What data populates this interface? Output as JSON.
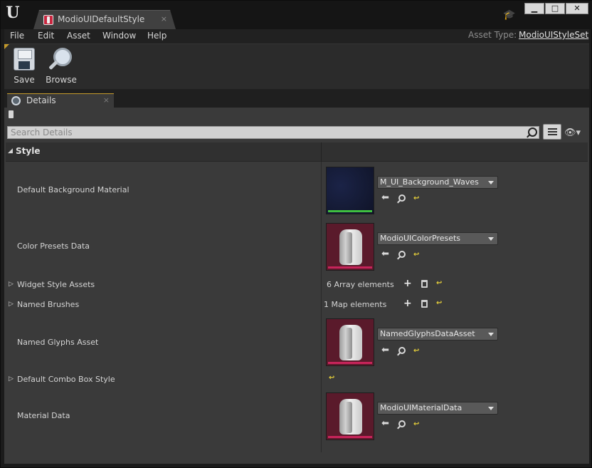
{
  "window": {
    "tab_title": "ModioUIDefaultStyle",
    "tab_close": "×",
    "buttons": {
      "minimize": "▁",
      "maximize": "□",
      "close": "✕"
    }
  },
  "menu": {
    "items": [
      "File",
      "Edit",
      "Asset",
      "Window",
      "Help"
    ],
    "asset_type_label": "Asset Type:",
    "asset_type_value": "ModioUIStyleSet"
  },
  "toolbar": {
    "save_label": "Save",
    "browse_label": "Browse"
  },
  "details": {
    "tab_label": "Details",
    "tab_close": "×",
    "search_placeholder": "Search Details",
    "category": "Style",
    "rows": {
      "default_background_material": {
        "label": "Default Background Material",
        "asset": "M_UI_Background_Waves",
        "thumb_bar_color": "#3fbf3f"
      },
      "color_presets_data": {
        "label": "Color Presets Data",
        "asset": "ModioUIColorPresets",
        "thumb_bar_color": "#c6245a"
      },
      "widget_style_assets": {
        "label": "Widget Style Assets",
        "value": "6 Array elements"
      },
      "named_brushes": {
        "label": "Named Brushes",
        "value": "1 Map elements"
      },
      "named_glyphs_asset": {
        "label": "Named Glyphs Asset",
        "asset": "NamedGlyphsDataAsset",
        "thumb_bar_color": "#c6245a"
      },
      "default_combo_box_style": {
        "label": "Default Combo Box Style"
      },
      "material_data": {
        "label": "Material Data",
        "asset": "ModioUIMaterialData",
        "thumb_bar_color": "#c6245a"
      }
    }
  },
  "colors": {
    "accent": "#c49a2b",
    "reset_arrow": "#e2cc3a",
    "thumb_background": "#5a1a2b"
  }
}
